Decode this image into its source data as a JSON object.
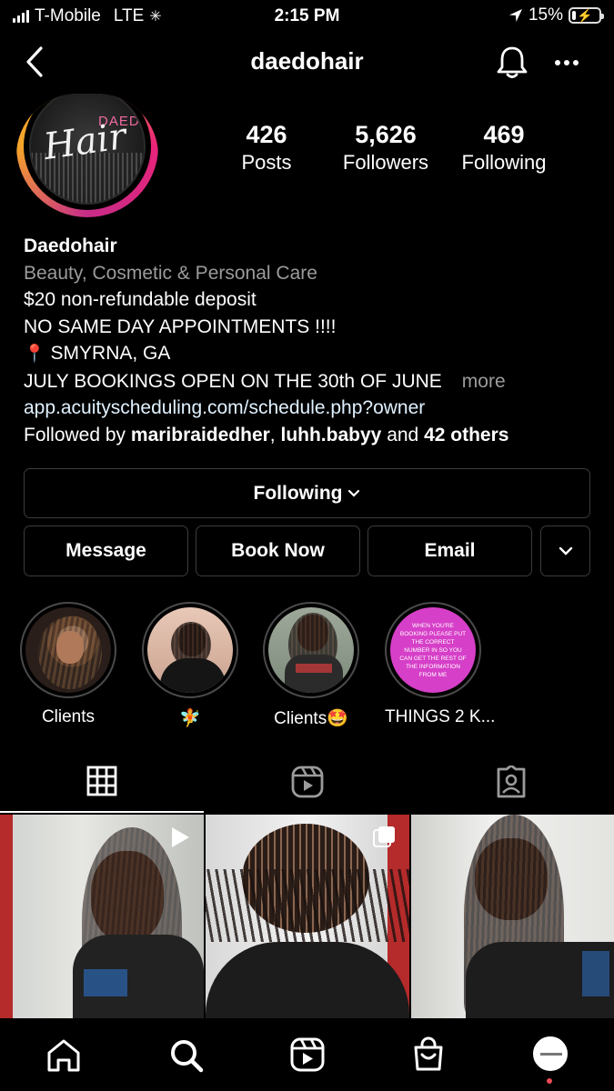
{
  "status_bar": {
    "carrier": "T-Mobile",
    "network": "LTE",
    "time": "2:15 PM",
    "battery_percent": "15%",
    "battery_level": 0.15
  },
  "header": {
    "username": "daedohair",
    "back_icon": "chevron-left-icon",
    "bell_icon": "bell-icon",
    "more_icon": "more-dots-icon"
  },
  "avatar": {
    "logo_text": "Hair",
    "logo_small": "DAEDO"
  },
  "stats": [
    {
      "value": "426",
      "label": "Posts"
    },
    {
      "value": "5,626",
      "label": "Followers"
    },
    {
      "value": "469",
      "label": "Following"
    }
  ],
  "bio": {
    "name": "Daedohair",
    "category": "Beauty, Cosmetic & Personal Care",
    "line1": "$20 non-refundable deposit",
    "line2": "NO SAME DAY APPOINTMENTS !!!!",
    "location_pin": "📍",
    "location": "SMYRNA, GA",
    "line4": "JULY BOOKINGS OPEN ON THE 30th OF JUNE",
    "more": "more",
    "link": "app.acuityscheduling.com/schedule.php?owner",
    "followed_prefix": "Followed by",
    "followed_user1": "maribraidedher",
    "followed_sep": ",",
    "followed_user2": "luhh.babyy",
    "followed_and": "and",
    "followed_others": "42 others"
  },
  "buttons": {
    "following": "Following",
    "message": "Message",
    "book_now": "Book Now",
    "email": "Email"
  },
  "highlights": [
    {
      "label": "Clients"
    },
    {
      "label": "🧚"
    },
    {
      "label": "Clients🤩"
    },
    {
      "label": "THINGS 2 K...",
      "cover_text": "WHEN YOU'RE BOOKING PLEASE PUT THE CORRECT NUMBER IN SO YOU CAN GET THE REST OF THE INFORMATION FROM ME",
      "cover_color": "#d63fc8"
    }
  ],
  "tabs": [
    {
      "icon": "grid-icon",
      "active": true
    },
    {
      "icon": "reels-icon",
      "active": false
    },
    {
      "icon": "tagged-icon",
      "active": false
    }
  ],
  "nav": [
    {
      "icon": "home-icon"
    },
    {
      "icon": "search-icon"
    },
    {
      "icon": "reels-icon"
    },
    {
      "icon": "shop-icon"
    },
    {
      "icon": "profile-avatar-icon"
    }
  ],
  "colors": {
    "background": "#000000",
    "secondary_text": "#9b9b9b",
    "link_text": "#e0f1ff",
    "border": "#3c3c3c",
    "notification_dot": "#ed4956"
  }
}
